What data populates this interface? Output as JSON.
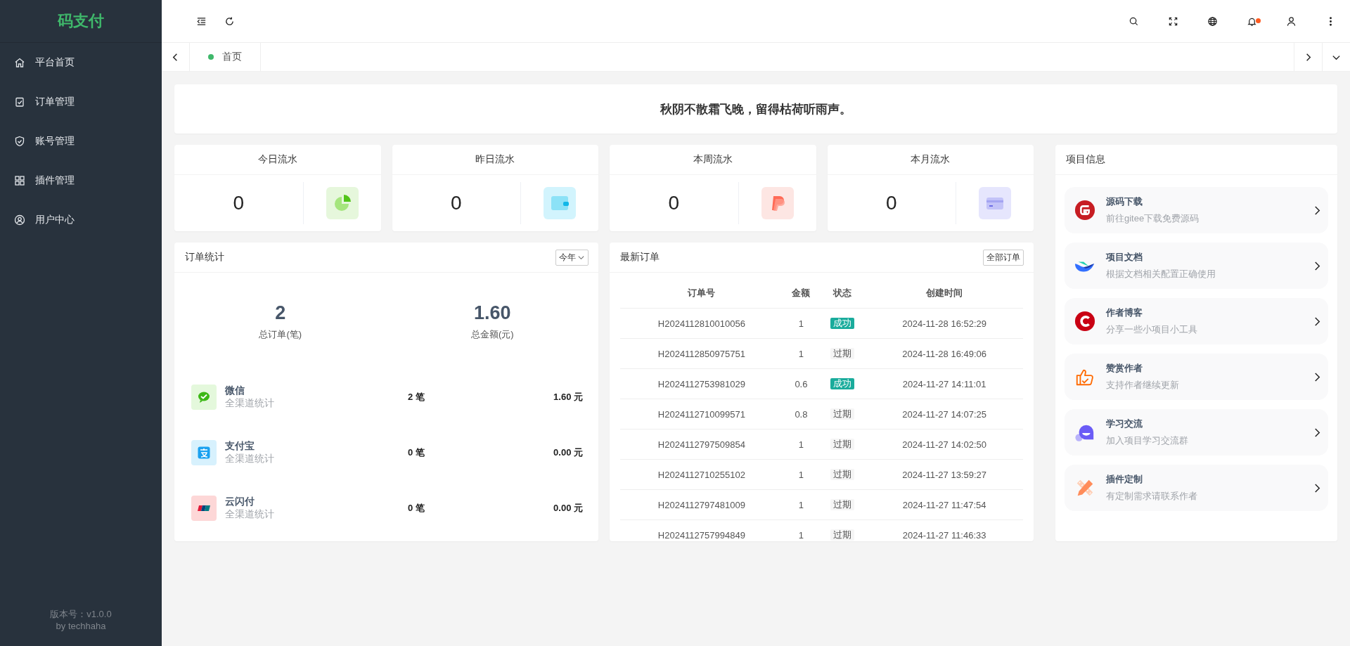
{
  "sidebar": {
    "logo": "码支付",
    "items": [
      {
        "label": "平台首页",
        "kind": "home",
        "selected": false
      },
      {
        "label": "订单管理",
        "kind": "clipboard",
        "selected": false
      },
      {
        "label": "账号管理",
        "kind": "shield",
        "selected": false
      },
      {
        "label": "插件管理",
        "kind": "grid",
        "selected": false
      },
      {
        "label": "用户中心",
        "kind": "user",
        "selected": false
      }
    ],
    "version": "版本号：v1.0.0",
    "author": "by techhaha"
  },
  "header": {
    "left_tools": [
      {
        "kind": "fold"
      },
      {
        "kind": "refresh"
      }
    ],
    "right_tools": [
      {
        "kind": "search",
        "dot": false
      },
      {
        "kind": "fullscreen",
        "dot": false
      },
      {
        "kind": "globe",
        "dot": false
      },
      {
        "kind": "bell",
        "dot": true
      },
      {
        "kind": "user",
        "dot": false
      },
      {
        "kind": "more",
        "dot": false
      }
    ]
  },
  "tabs": [
    {
      "label": "首页",
      "selected": true
    }
  ],
  "banner": "秋阴不散霜飞晚，留得枯荷听雨声。",
  "stat_cards": [
    {
      "title": "今日流水",
      "value": "0",
      "kind": "pie"
    },
    {
      "title": "昨日流水",
      "value": "0",
      "kind": "wallet"
    },
    {
      "title": "本周流水",
      "value": "0",
      "kind": "paypal"
    },
    {
      "title": "本月流水",
      "value": "0",
      "kind": "card"
    }
  ],
  "order_stats": {
    "title": "订单统计",
    "period": "今年",
    "total_orders": "2",
    "total_orders_label": "总订单(笔)",
    "total_amount": "1.60",
    "total_amount_label": "总金额(元)",
    "channels": [
      {
        "name": "微信",
        "sub": "全渠道统计",
        "count": "2 笔",
        "amount": "1.60 元",
        "kind": "wechat"
      },
      {
        "name": "支付宝",
        "sub": "全渠道统计",
        "count": "0 笔",
        "amount": "0.00 元",
        "kind": "alipay"
      },
      {
        "name": "云闪付",
        "sub": "全渠道统计",
        "count": "0 笔",
        "amount": "0.00 元",
        "kind": "unionpay"
      }
    ]
  },
  "latest_orders": {
    "title": "最新订单",
    "button": "全部订单",
    "columns": [
      "订单号",
      "金额",
      "状态",
      "创建时间"
    ],
    "rows": [
      {
        "order_no": "H2024112810010056",
        "amount": "1",
        "status": {
          "label": "成功",
          "kind": "success"
        },
        "created": "2024-11-28 16:52:29"
      },
      {
        "order_no": "H2024112850975751",
        "amount": "1",
        "status": {
          "label": "过期",
          "kind": "expired"
        },
        "created": "2024-11-28 16:49:06"
      },
      {
        "order_no": "H2024112753981029",
        "amount": "0.6",
        "status": {
          "label": "成功",
          "kind": "success"
        },
        "created": "2024-11-27 14:11:01"
      },
      {
        "order_no": "H2024112710099571",
        "amount": "0.8",
        "status": {
          "label": "过期",
          "kind": "expired"
        },
        "created": "2024-11-27 14:07:25"
      },
      {
        "order_no": "H2024112797509854",
        "amount": "1",
        "status": {
          "label": "过期",
          "kind": "expired"
        },
        "created": "2024-11-27 14:02:50"
      },
      {
        "order_no": "H2024112710255102",
        "amount": "1",
        "status": {
          "label": "过期",
          "kind": "expired"
        },
        "created": "2024-11-27 13:59:27"
      },
      {
        "order_no": "H2024112797481009",
        "amount": "1",
        "status": {
          "label": "过期",
          "kind": "expired"
        },
        "created": "2024-11-27 11:47:54"
      },
      {
        "order_no": "H2024112757994849",
        "amount": "1",
        "status": {
          "label": "过期",
          "kind": "expired"
        },
        "created": "2024-11-27 11:46:33"
      }
    ]
  },
  "project_info": {
    "title": "项目信息",
    "links": [
      {
        "title": "源码下载",
        "desc": "前往gitee下载免费源码",
        "kind": "gitee"
      },
      {
        "title": "项目文档",
        "desc": "根据文档相关配置正确使用",
        "kind": "docs"
      },
      {
        "title": "作者博客",
        "desc": "分享一些小项目小工具",
        "kind": "blog"
      },
      {
        "title": "赞赏作者",
        "desc": "支持作者继续更新",
        "kind": "thumb"
      },
      {
        "title": "学习交流",
        "desc": "加入项目学习交流群",
        "kind": "chat"
      },
      {
        "title": "插件定制",
        "desc": "有定制需求请联系作者",
        "kind": "pencil"
      }
    ]
  }
}
